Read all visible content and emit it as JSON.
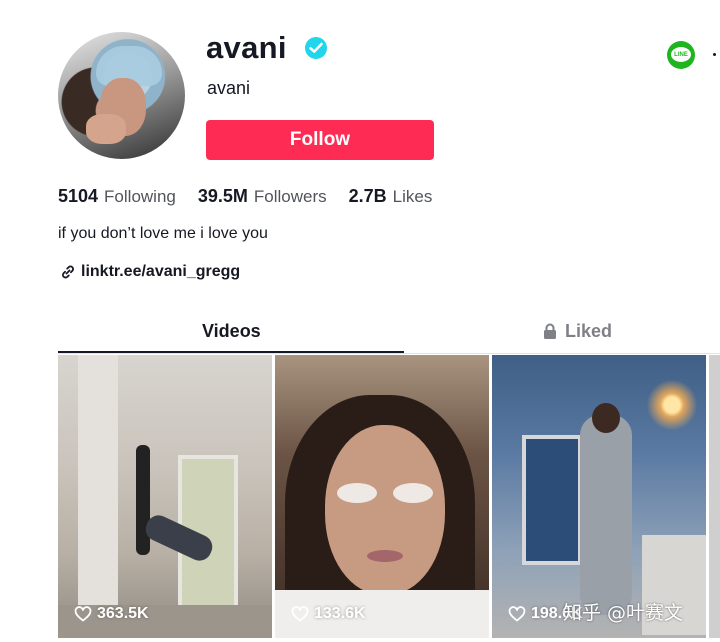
{
  "profile": {
    "username": "avani",
    "nickname": "avani",
    "verified": true,
    "follow_label": "Follow",
    "bio": "if you don’t love me i love you",
    "link": "linktr.ee/avani_gregg"
  },
  "stats": [
    {
      "value": "5104",
      "label": "Following"
    },
    {
      "value": "39.5M",
      "label": "Followers"
    },
    {
      "value": "2.7B",
      "label": "Likes"
    }
  ],
  "share": {
    "line_label": "LINE"
  },
  "tabs": {
    "videos": "Videos",
    "liked": "Liked",
    "active": "Videos"
  },
  "videos": [
    {
      "views": "363.5K"
    },
    {
      "views": "133.6K"
    },
    {
      "views": "198.6K"
    }
  ],
  "watermark": "知乎 @叶赛文",
  "colors": {
    "accent": "#fe2c55",
    "verified": "#20d5ec",
    "line": "#1fb51f",
    "text": "#161823"
  }
}
